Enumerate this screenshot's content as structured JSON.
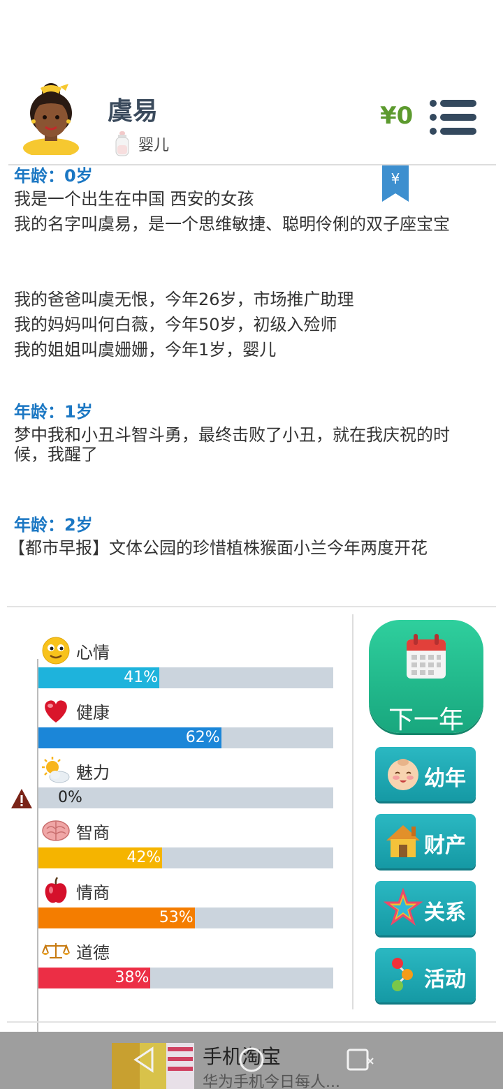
{
  "header": {
    "name": "虞易",
    "stage_label": "婴儿",
    "money": "¥0",
    "bookmark_symbol": "¥"
  },
  "log": {
    "entries": [
      {
        "age": "年龄：0岁",
        "lines": [
          "我是一个出生在中国 西安的女孩",
          "我的名字叫虞易，是一个思维敏捷、聪明伶俐的双子座宝宝",
          "我的爸爸叫虞无恨，今年26岁，市场推广助理",
          "我的妈妈叫何白薇，今年50岁，初级入殓师",
          "我的姐姐叫虞姗姗，今年1岁，婴儿"
        ]
      },
      {
        "age": "年龄：1岁",
        "lines": [
          "梦中我和小丑斗智斗勇，最终击败了小丑，就在我庆祝的时候，我醒了"
        ]
      },
      {
        "age": "年龄：2岁",
        "lines": [
          "【都市早报】文体公园的珍惜植株猴面小兰今年两度开花"
        ]
      }
    ]
  },
  "stats": [
    {
      "label": "心情",
      "icon": "smiley-icon",
      "value": 41,
      "text": "41%",
      "color": "#1eb3dc"
    },
    {
      "label": "健康",
      "icon": "heart-icon",
      "value": 62,
      "text": "62%",
      "color": "#1b86d8"
    },
    {
      "label": "魅力",
      "icon": "sun-cloud-icon",
      "value": 0,
      "text": "0%",
      "color": "#a06ad4"
    },
    {
      "label": "智商",
      "icon": "brain-icon",
      "value": 42,
      "text": "42%",
      "color": "#f5b400"
    },
    {
      "label": "情商",
      "icon": "apple-icon",
      "value": 53,
      "text": "53%",
      "color": "#f47d00"
    },
    {
      "label": "道德",
      "icon": "scales-icon",
      "value": 38,
      "text": "38%",
      "color": "#ec2e45"
    }
  ],
  "buttons": {
    "next_year": "下一年",
    "childhood": "幼年",
    "assets": "财产",
    "relations": "关系",
    "activities": "活动"
  },
  "ad": {
    "title": "手机淘宝",
    "subtitle": "华为手机今日每人..."
  }
}
